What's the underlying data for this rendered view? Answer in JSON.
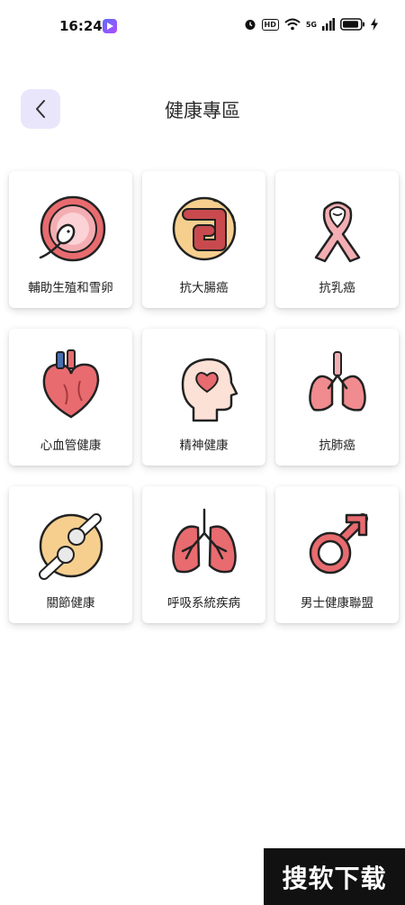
{
  "status_bar": {
    "time": "16:24",
    "hd": "HD",
    "network": "5G"
  },
  "header": {
    "title": "健康專區"
  },
  "categories": [
    {
      "label": "輔助生殖和雪卵",
      "icon": "reproduction-icon"
    },
    {
      "label": "抗大腸癌",
      "icon": "colon-icon"
    },
    {
      "label": "抗乳癌",
      "icon": "pink-ribbon-icon"
    },
    {
      "label": "心血管健康",
      "icon": "heart-icon"
    },
    {
      "label": "精神健康",
      "icon": "mind-head-icon"
    },
    {
      "label": "抗肺癌",
      "icon": "lungs-icon"
    },
    {
      "label": "關節健康",
      "icon": "joint-icon"
    },
    {
      "label": "呼吸系統疾病",
      "icon": "respiratory-lungs-icon"
    },
    {
      "label": "男士健康聯盟",
      "icon": "male-symbol-icon"
    }
  ],
  "watermark": {
    "text": "搜软下载"
  },
  "colors": {
    "accent_bg": "#e9e6fb",
    "icon_red": "#e86b6f",
    "icon_pink": "#f4aeb3",
    "icon_yellow": "#f6cf8f"
  }
}
